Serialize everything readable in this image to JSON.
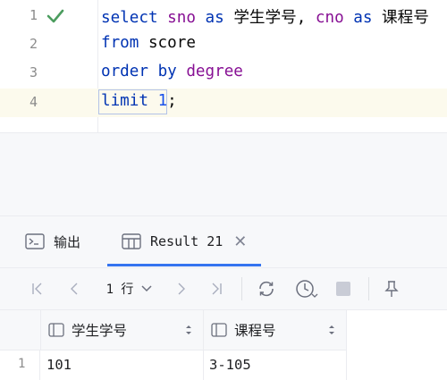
{
  "editor": {
    "lines": [
      {
        "number": "1",
        "status_icon": "check-icon"
      },
      {
        "number": "2"
      },
      {
        "number": "3"
      },
      {
        "number": "4"
      }
    ],
    "code": {
      "line1": {
        "kw_select": "select",
        "id_sno": "sno",
        "kw_as1": "as",
        "alias1": "学生学号",
        "comma": ",",
        "id_cno": "cno",
        "kw_as2": "as",
        "alias2": "课程号"
      },
      "line2": {
        "kw_from": "from",
        "table": "score"
      },
      "line3": {
        "kw_order": "order",
        "kw_by": "by",
        "id_degree": "degree"
      },
      "line4": {
        "kw_limit": "limit",
        "num": "1",
        "semicolon": ";"
      }
    }
  },
  "tool_window": {
    "tabs": [
      {
        "label": "输出",
        "icon": "console-icon",
        "active": false
      },
      {
        "label": "Result 21",
        "icon": "table-icon",
        "active": true
      }
    ],
    "toolbar": {
      "page_label": "1 行"
    },
    "grid": {
      "columns": [
        "学生学号",
        "课程号"
      ],
      "rows": [
        {
          "row_number": "1",
          "cells": [
            "101",
            "3-105"
          ]
        }
      ]
    }
  },
  "colors": {
    "keyword": "#0033b3",
    "identifier": "#871094",
    "number": "#1750eb",
    "success": "#4c9d5f",
    "accent": "#3574f0"
  }
}
